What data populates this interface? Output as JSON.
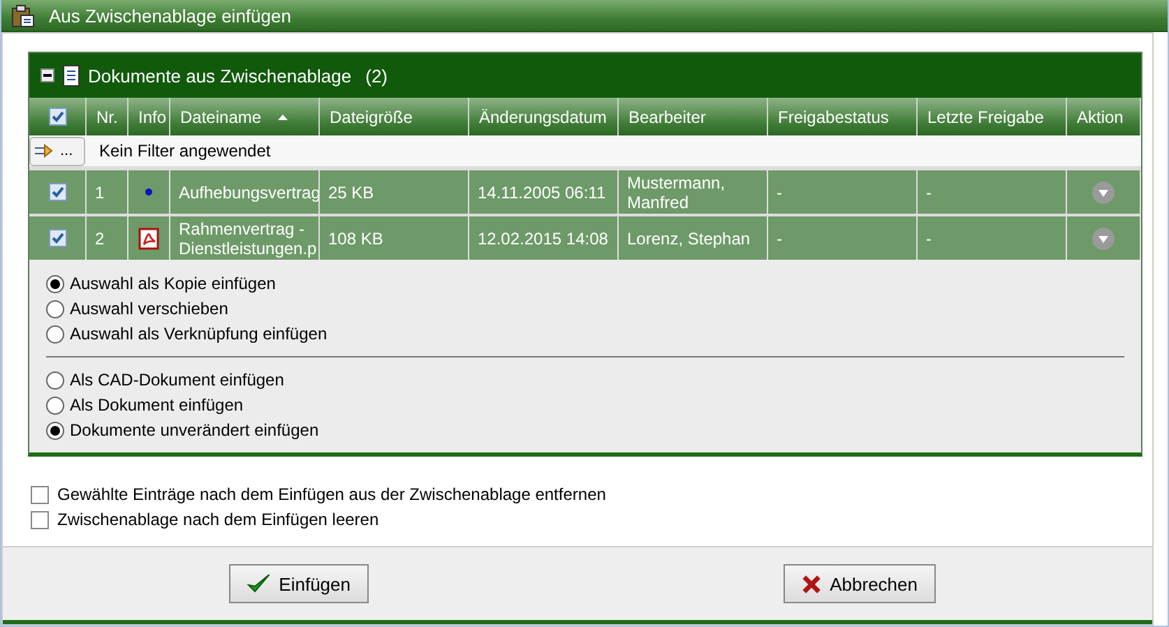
{
  "window": {
    "title": "Aus Zwischenablage einfügen"
  },
  "panel": {
    "title": "Dokumente aus Zwischenablage",
    "count": "(2)",
    "expanded": true
  },
  "table": {
    "select_all": {
      "checked": true
    },
    "columns": [
      {
        "label": "Nr."
      },
      {
        "label": "Info"
      },
      {
        "label": "Dateiname",
        "sorted": true
      },
      {
        "label": "Dateigröße"
      },
      {
        "label": "Änderungsdatum"
      },
      {
        "label": "Bearbeiter"
      },
      {
        "label": "Freigabestatus"
      },
      {
        "label": "Letzte Freigabe"
      },
      {
        "label": "Aktion"
      }
    ],
    "filter": {
      "button": "...",
      "text": "Kein Filter angewendet"
    },
    "rows": [
      {
        "checked": true,
        "nr": "1",
        "kind": "dot",
        "filename": "Aufhebungsvertrag",
        "size": "25 KB",
        "date": "14.11.2005 06:11",
        "editor": "Mustermann, Manfred",
        "status": "-",
        "last_release": "-"
      },
      {
        "checked": true,
        "nr": "2",
        "kind": "pdf",
        "filename": "Rahmenvertrag - Dienstleistungen.p",
        "size": "108 KB",
        "date": "12.02.2015 14:08",
        "editor": "Lorenz, Stephan",
        "status": "-",
        "last_release": "-"
      }
    ]
  },
  "option_groups": [
    [
      {
        "label": "Auswahl als Kopie einfügen",
        "selected": true
      },
      {
        "label": "Auswahl verschieben",
        "selected": false
      },
      {
        "label": "Auswahl als Verknüpfung einfügen",
        "selected": false
      }
    ],
    [
      {
        "label": "Als CAD-Dokument einfügen",
        "selected": false
      },
      {
        "label": "Als Dokument einfügen",
        "selected": false
      },
      {
        "label": "Dokumente unverändert einfügen",
        "selected": true
      }
    ]
  ],
  "checkboxes": [
    {
      "label": "Gewählte Einträge nach dem Einfügen aus der Zwischenablage entfernen",
      "checked": false
    },
    {
      "label": "Zwischenablage nach dem Einfügen leeren",
      "checked": false
    }
  ],
  "buttons": [
    {
      "label": "Einfügen",
      "kind": "ok"
    },
    {
      "label": "Abbrechen",
      "kind": "cancel"
    }
  ]
}
